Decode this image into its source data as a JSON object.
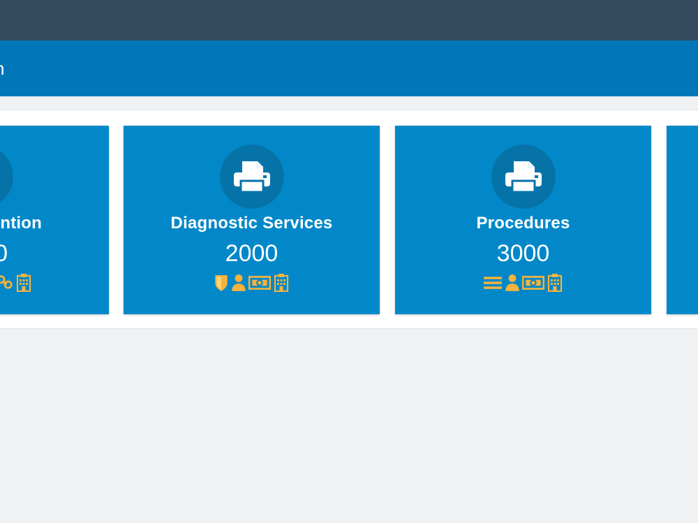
{
  "header": {
    "title_fragment": "n"
  },
  "tiles": [
    {
      "name": "ntion",
      "value": "0",
      "icon": "printer-icon",
      "sub_icons": [
        "link-icon",
        "hospital-icon"
      ]
    },
    {
      "name": "Diagnostic Services",
      "value": "2000",
      "icon": "printer-icon",
      "sub_icons": [
        "shield-icon",
        "user-icon",
        "money-icon",
        "hospital-icon"
      ]
    },
    {
      "name": "Procedures",
      "value": "3000",
      "icon": "printer-icon",
      "sub_icons": [
        "menu-icon",
        "user-icon",
        "money-icon",
        "hospital-icon"
      ]
    }
  ],
  "colors": {
    "topbar": "#344a5f",
    "titlebar": "#0277b8",
    "tile": "#0288c9",
    "icon_circle": "#0673a8",
    "accent_icons": "#f5b33d"
  }
}
